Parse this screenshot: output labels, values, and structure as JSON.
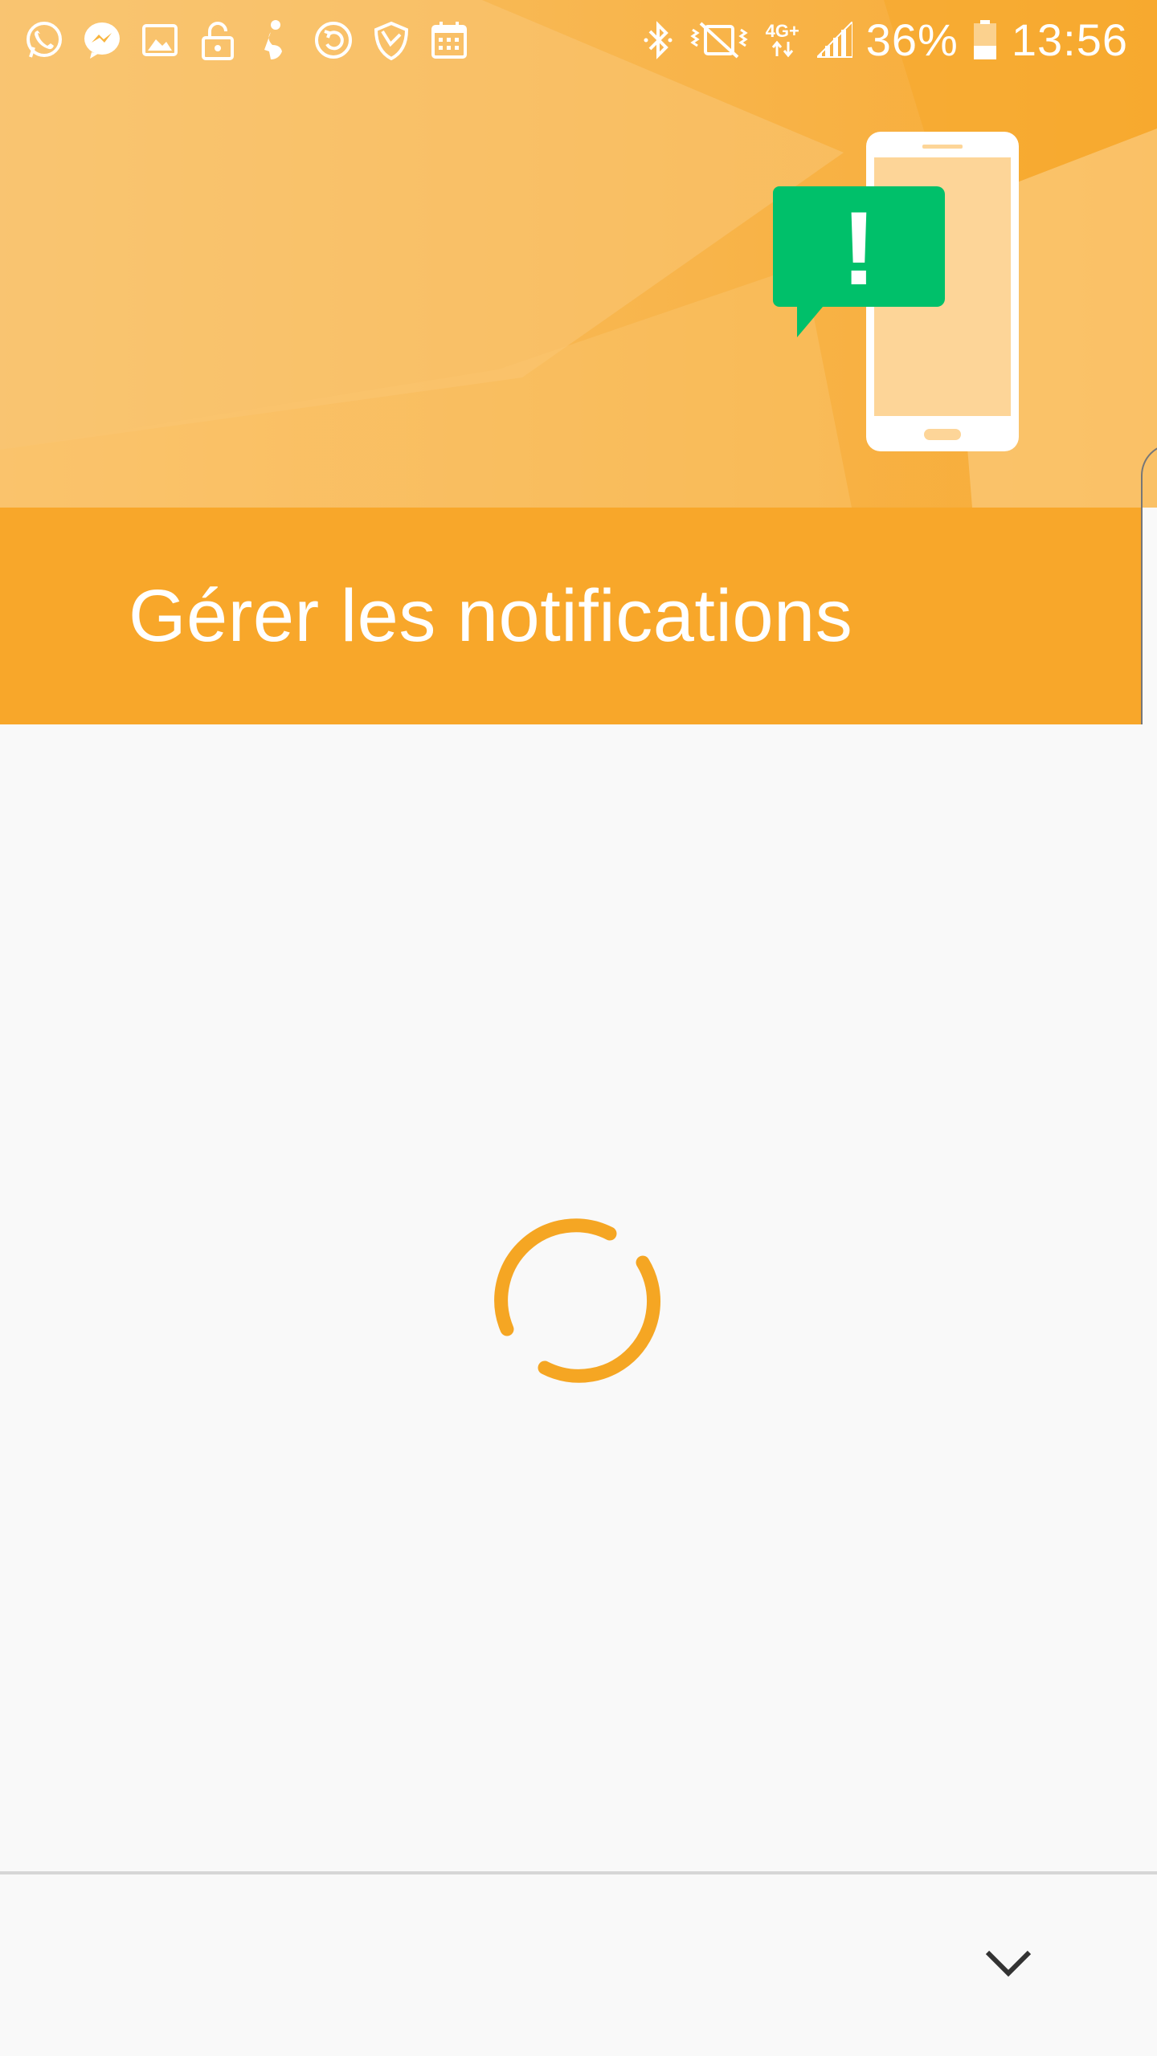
{
  "status_bar": {
    "left_icons": [
      "whatsapp-icon",
      "messenger-icon",
      "gallery-icon",
      "lock-open-icon",
      "pregnancy-app-icon",
      "sync-icon",
      "shield-app-icon",
      "calendar-icon"
    ],
    "right_icons": [
      "bluetooth-icon",
      "vibrate-mute-icon",
      "network-4g-plus-icon",
      "signal-icon"
    ],
    "network_label": "4G+",
    "battery_percent": "36%",
    "battery_level": 0.36,
    "time": "13:56"
  },
  "header": {
    "title": "Gérer les notifications",
    "illustration": "phone-with-alert-bubble",
    "alert_glyph": "!"
  },
  "content": {
    "state": "loading",
    "spinner": "loading-spinner"
  },
  "bottom_bar": {
    "action_icon": "chevron-down-icon"
  },
  "colors": {
    "hero_bg": "#f8b540",
    "title_band": "#f8a72a",
    "spinner": "#f5a623",
    "alert_bubble": "#00c06a",
    "phone_screen": "#fdd598",
    "content_bg": "#f9f9f9",
    "chevron": "#333333"
  }
}
